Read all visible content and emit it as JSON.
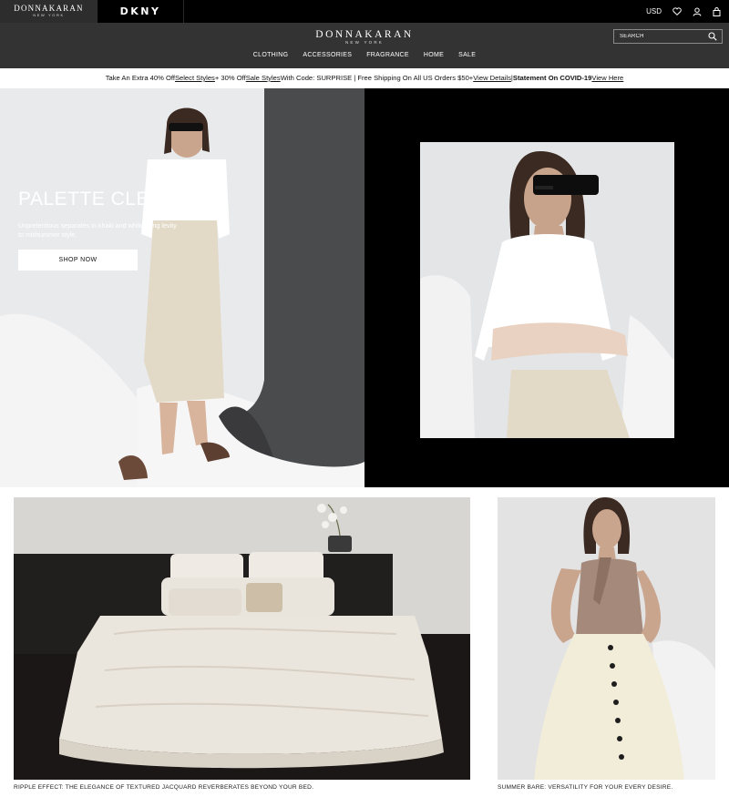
{
  "brands": {
    "donna_karan": {
      "line1": "DONNAKARAN",
      "line2": "NEW YORK"
    },
    "dkny": "DKNY"
  },
  "utility": {
    "currency": "USD"
  },
  "header": {
    "logo_line1": "DONNAKARAN",
    "logo_line2": "NEW YORK",
    "search_placeholder": "SEARCH",
    "nav": [
      "CLOTHING",
      "ACCESSORIES",
      "FRAGRANCE",
      "HOME",
      "SALE"
    ]
  },
  "promo": {
    "p1": "Take An Extra 40% Off ",
    "link1": "Select Styles",
    "p2": " + 30% Off ",
    "link2": "Sale Styles",
    "p3": " With Code: SURPRISE | Free Shipping On All US Orders $50+ ",
    "link3": "View Details",
    "p4": " | ",
    "bold": "Statement On COVID-19",
    "p5": " ",
    "link4": "View Here"
  },
  "hero": {
    "title": "PALETTE CLEANSER",
    "subtitle": "Unpretentious separates in khaki and white bring levity to midsummer style.",
    "button": "SHOP NOW"
  },
  "tiles": {
    "bed_caption": "RIPPLE EFFECT: THE ELEGANCE OF TEXTURED JACQUARD REVERBERATES BEYOND YOUR BED.",
    "skirt_caption": "SUMMER BARE: VERSATILITY FOR YOUR EVERY DESIRE."
  },
  "colors": {
    "header_bg": "#333333",
    "topbar_bg": "#000000",
    "hero_right_bg": "#000000"
  }
}
